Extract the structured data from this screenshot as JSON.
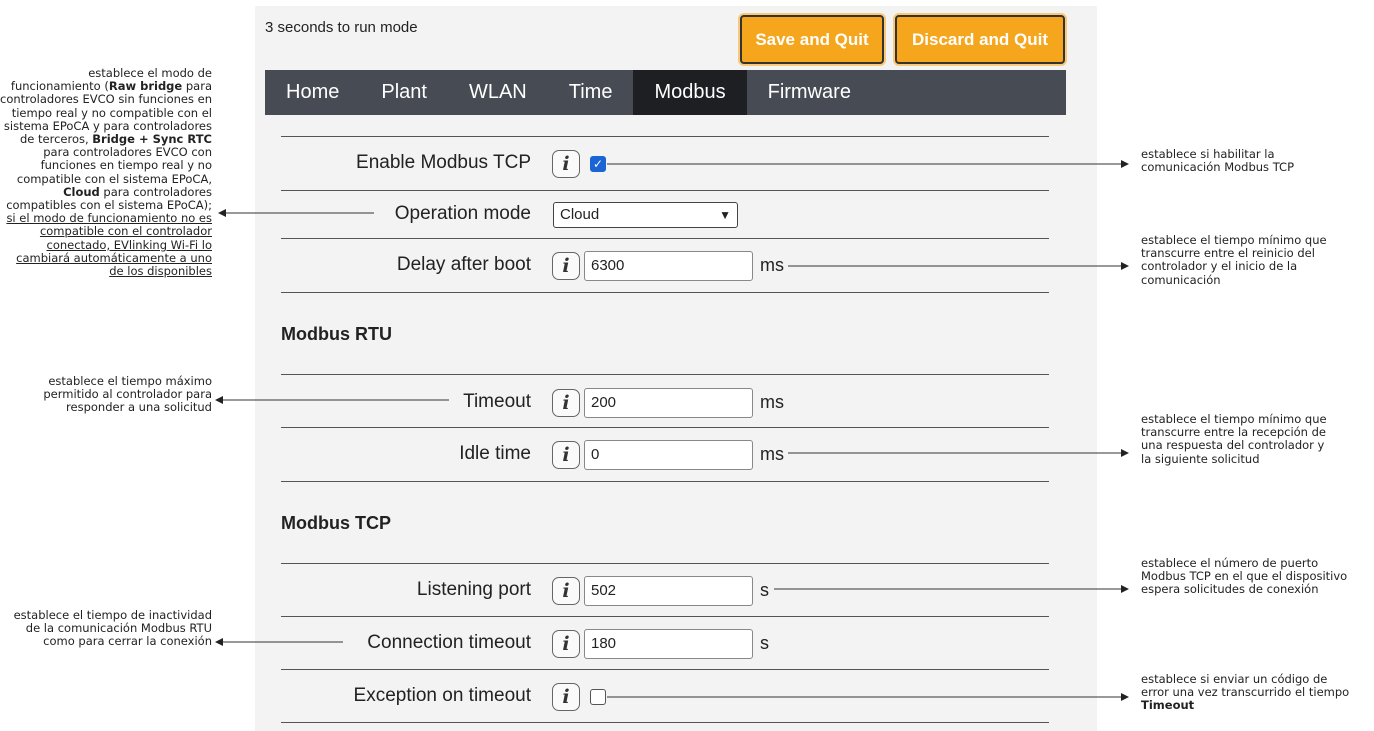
{
  "header": {
    "countdown": "3 seconds to run mode",
    "save_label": "Save and Quit",
    "discard_label": "Discard and Quit"
  },
  "tabs": [
    {
      "label": "Home",
      "active": false
    },
    {
      "label": "Plant",
      "active": false
    },
    {
      "label": "WLAN",
      "active": false
    },
    {
      "label": "Time",
      "active": false
    },
    {
      "label": "Modbus",
      "active": true
    },
    {
      "label": "Firmware",
      "active": false
    }
  ],
  "form": {
    "enable_tcp": {
      "label": "Enable Modbus TCP",
      "checked": true
    },
    "operation_mode": {
      "label": "Operation mode",
      "value": "Cloud"
    },
    "delay_after_boot": {
      "label": "Delay after boot",
      "value": "6300",
      "unit": "ms"
    },
    "rtu_title": "Modbus RTU",
    "timeout": {
      "label": "Timeout",
      "value": "200",
      "unit": "ms"
    },
    "idle_time": {
      "label": "Idle time",
      "value": "0",
      "unit": "ms"
    },
    "tcp_title": "Modbus TCP",
    "listening_port": {
      "label": "Listening port",
      "value": "502",
      "unit": "s"
    },
    "connection_timeout": {
      "label": "Connection timeout",
      "value": "180",
      "unit": "s"
    },
    "exception_on_timeout": {
      "label": "Exception on timeout",
      "checked": false
    }
  },
  "info_glyph": "i",
  "notes": {
    "operation_mode": {
      "t1": "establece el modo de funcionamiento (",
      "b1": "Raw bridge",
      "t2": " para controladores EVCO sin funciones en tiempo real y no compatible con el sistema EPoCA y para controladores de terceros, ",
      "b2": "Bridge + Sync RTC",
      "t3": " para controladores EVCO con funciones en tiempo real y no compatible con el sistema EPoCA, ",
      "b3": "Cloud",
      "t4": " para controladores compatibles con el sistema EPoCA); ",
      "u1": "si el modo de funcionamiento no es compatible con el controlador conectado, EVlinking Wi-Fi lo cambiará automáticamente a uno de los disponibles"
    },
    "timeout": "establece el tiempo máximo permitido al controlador para responder a una solicitud",
    "connection_timeout": "establece el tiempo de inactividad de la comunicación Modbus RTU como para cerrar la conexión",
    "enable_tcp": "establece si habilitar la comunicación Modbus TCP",
    "delay_after_boot": "establece el tiempo mínimo que transcurre entre el reinicio del controlador y el inicio de la comunicación",
    "idle_time": "establece el tiempo mínimo que transcurre entre la recepción de una respuesta del controlador y la siguiente solicitud",
    "listening_port": "establece el número de puerto Modbus TCP en el que el dispositivo espera solicitudes de conexión",
    "exception_on_timeout": {
      "t1": "establece si enviar un código de error una vez transcurrido el tiempo ",
      "b1": "Timeout"
    }
  }
}
